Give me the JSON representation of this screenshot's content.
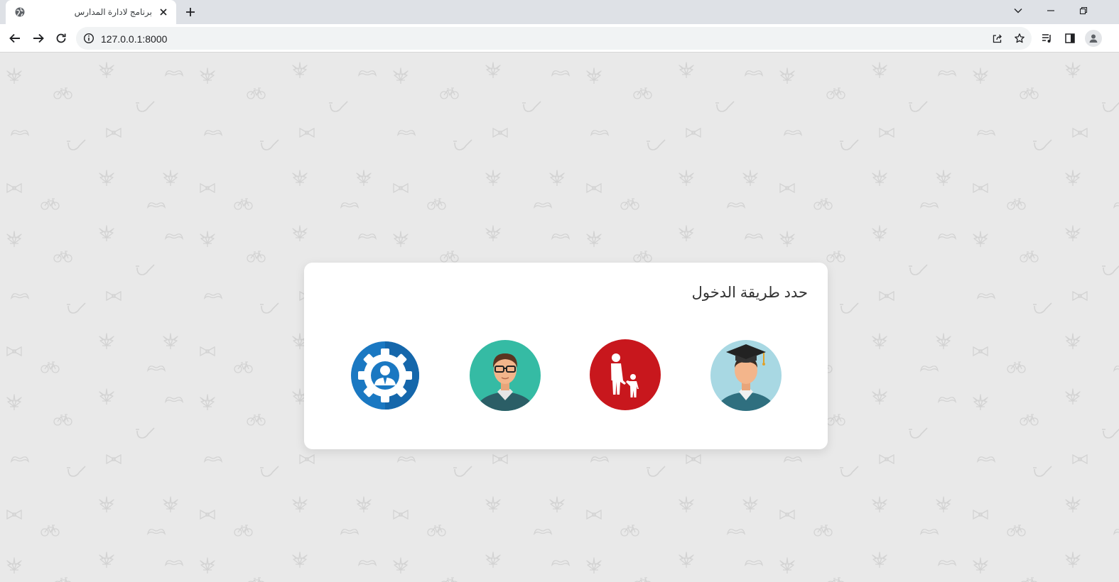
{
  "browser": {
    "tab_title": "برنامج لادارة المدارس",
    "url": "127.0.0.1:8000"
  },
  "page": {
    "heading": "حدد طريقة الدخول",
    "roles": [
      {
        "icon": "admin-gear-icon",
        "color": "#1a78c2"
      },
      {
        "icon": "teacher-icon",
        "color": "#35bba4"
      },
      {
        "icon": "parent-child-icon",
        "color": "#c8171d"
      },
      {
        "icon": "graduate-student-icon",
        "color": "#a8d8e3"
      }
    ]
  }
}
